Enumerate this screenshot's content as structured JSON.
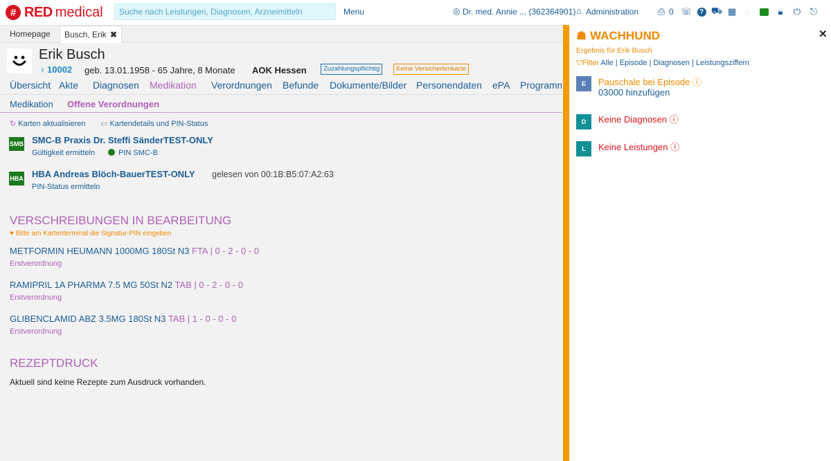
{
  "topbar": {
    "logo_red": "RED",
    "logo_medical": "medical",
    "logo_mark": "#",
    "search_placeholder": "Suche nach Leistungen, Diagnosen, Arzneimitteln",
    "menu_label": "Menu",
    "user_label": "Dr. med. Annie ... (362364901)",
    "admin_label": "Administration",
    "printer_count": "0"
  },
  "tabs": {
    "home": "Homepage",
    "patient": "Busch, Erik"
  },
  "patient": {
    "name": "Erik Busch",
    "id": "10002",
    "birth": "geb. 13.01.1958 - 65 Jahre, 8 Monate",
    "insurance": "AOK Hessen",
    "badge_copay": "Zuzahlungspflichtig",
    "badge_card": "Keine Versichertenkarte"
  },
  "nav": [
    "Übersicht",
    "Akte",
    "Diagnosen",
    "Medikation",
    "Verordnungen",
    "Befunde",
    "Dokumente/Bilder",
    "Personendaten",
    "ePA",
    "Programm"
  ],
  "subnav": [
    "Medikation",
    "Offene Verordnungen"
  ],
  "cards": {
    "refresh": "Karten aktualisieren",
    "details": "Kartendetails und PIN-Status",
    "smcb": {
      "tag": "SMB",
      "title": "SMC-B Praxis Dr. Steffi SänderTEST-ONLY",
      "action": "Gültigkeit ermitteln",
      "pin": "PIN SMC-B"
    },
    "hba": {
      "tag": "HBA",
      "title": "HBA Andreas Blöch-BauerTEST-ONLY",
      "read": "gelesen von 00:1B:B5:07:A2:63",
      "action": "PIN-Status ermitteln"
    }
  },
  "prescriptions": {
    "heading": "VERSCHREIBUNGEN IN BEARBEITUNG",
    "hint": "Bitte am Kartenterminal die Signatur-PIN eingeben",
    "items": [
      {
        "name": "METFORMIN HEUMANN 1000MG 180St N3",
        "suffix": "FTA | 0 - 2 - 0 - 0",
        "type": "Erstverordnung"
      },
      {
        "name": "RAMIPRIL 1A PHARMA 7.5 MG 50St N2",
        "suffix": "TAB | 0 - 2 - 0 - 0",
        "type": "Erstverordnung"
      },
      {
        "name": "GLIBENCLAMID ABZ 3.5MG 180St N3",
        "suffix": "TAB | 1 - 0 - 0 - 0",
        "type": "Erstverordnung"
      }
    ]
  },
  "print": {
    "heading": "REZEPTDRUCK",
    "text": "Aktuell sind keine Rezepte zum Ausdruck vorhanden."
  },
  "watchdog": {
    "title": "WACHHUND",
    "subtitle": "Ergebnis für Erik Busch",
    "filter_label": "Filter",
    "filters": [
      "Alle",
      "Episode",
      "Diagnosen",
      "Leistungsziffern"
    ],
    "items": [
      {
        "tag": "E",
        "title": "Pauschale bei Episode",
        "detail": "03000 hinzufügen",
        "color": "#5a7fb6"
      },
      {
        "tag": "D",
        "title": "Keine Diagnosen",
        "color": "#138f96"
      },
      {
        "tag": "L",
        "title": "Keine Leistungen",
        "color": "#138f96"
      }
    ]
  },
  "colors": {
    "brand": "#d9141e",
    "accent": "#f59a00",
    "link": "#1a5d96",
    "active": "#b060b8",
    "error": "#e0161e"
  }
}
